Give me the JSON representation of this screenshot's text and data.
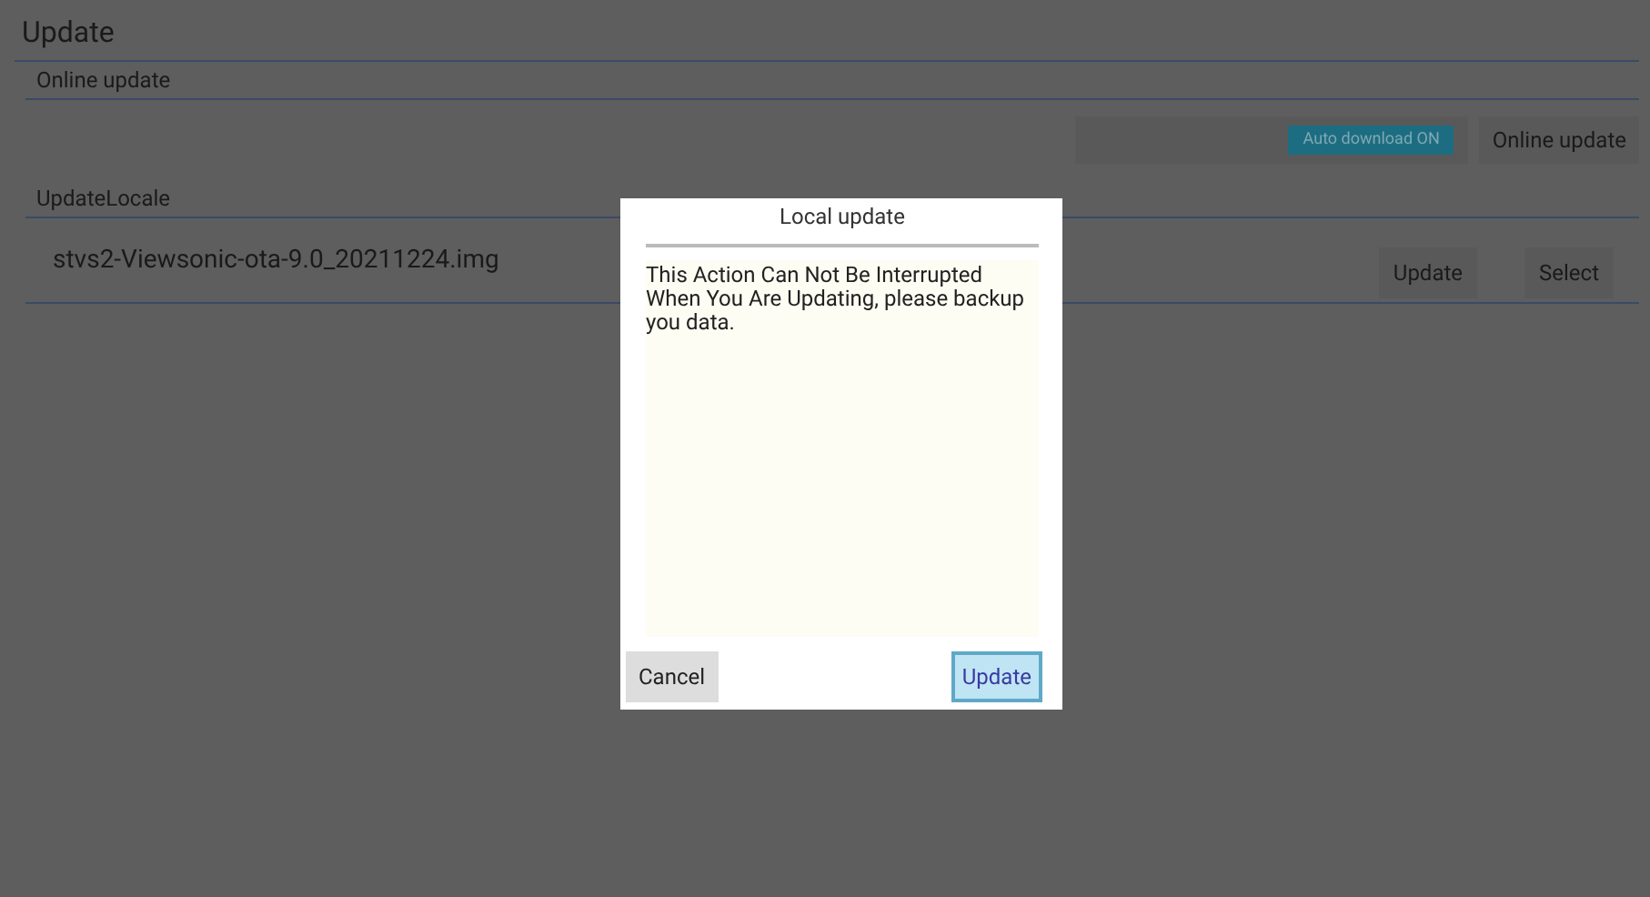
{
  "title": "Update",
  "online_update": {
    "heading": "Online update",
    "auto_download": {
      "label": "Auto download ON",
      "on": true
    },
    "button": "Online update"
  },
  "local_update": {
    "heading": "UpdateLocale",
    "file_name": "stvs2-Viewsonic-ota-9.0_20211224.img",
    "buttons": [
      "Update",
      "Select"
    ]
  },
  "dialog": {
    "title": "Local update",
    "message": "This Action Can Not Be Interrupted When You Are Updating, please backup you data.",
    "buttons": [
      {
        "label": "Cancel",
        "selected": false
      },
      {
        "label": "Update",
        "selected": true
      }
    ]
  }
}
